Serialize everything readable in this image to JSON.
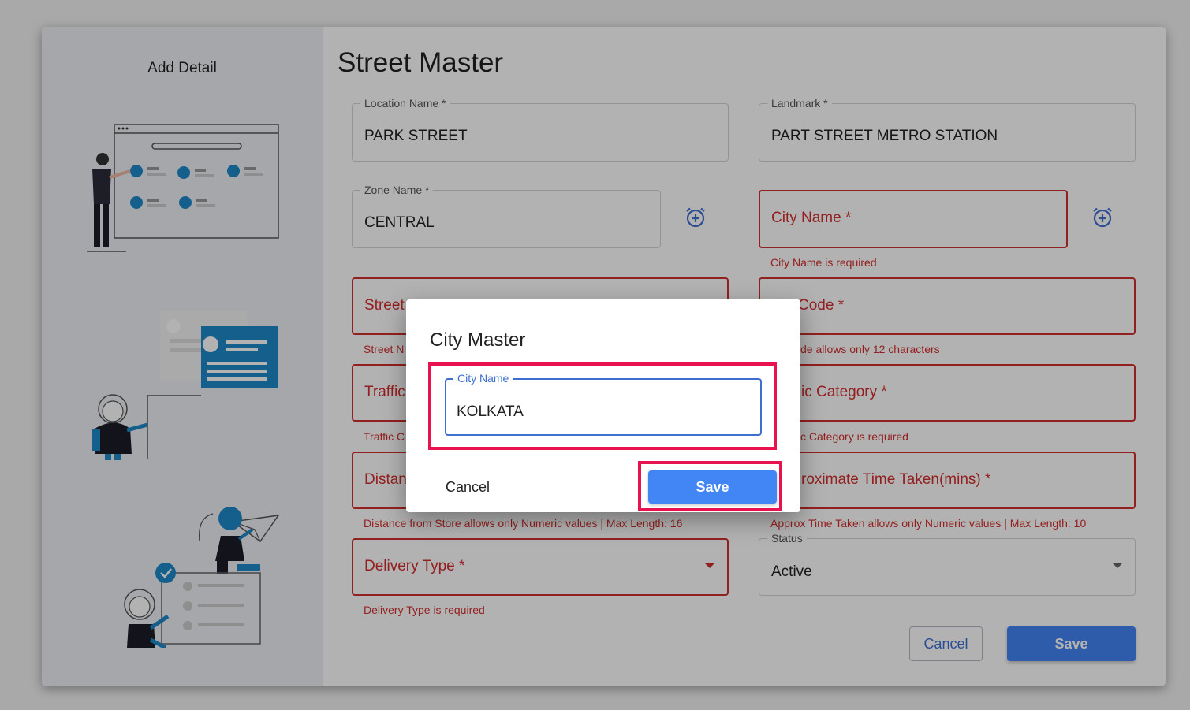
{
  "sidebar": {
    "title": "Add Detail"
  },
  "page": {
    "title": "Street Master"
  },
  "fields": {
    "location_name": {
      "label": "Location Name *",
      "value": "PARK STREET"
    },
    "landmark": {
      "label": "Landmark *",
      "value": "PART STREET METRO STATION"
    },
    "zone_name": {
      "label": "Zone Name *",
      "value": "CENTRAL"
    },
    "city_name": {
      "placeholder": "City Name *",
      "error": "City Name is required"
    },
    "street_name": {
      "placeholder": "Street",
      "error": "Street N"
    },
    "pin_code": {
      "placeholder": "Code *",
      "error": "de allows only 12 characters"
    },
    "traffic": {
      "placeholder": "Traffic",
      "error": "Traffic C"
    },
    "traffic_category": {
      "placeholder": "ic Category *",
      "error": "c Category is required"
    },
    "distance": {
      "placeholder": "Distan",
      "error": "Distance from Store allows only Numeric values | Max Length: 16"
    },
    "approx_time": {
      "placeholder": "roximate Time Taken(mins) *",
      "error": "Approx Time Taken allows only Numeric values | Max Length: 10"
    },
    "delivery_type": {
      "placeholder": "Delivery Type *",
      "error": "Delivery Type is required"
    },
    "status": {
      "label": "Status",
      "value": "Active"
    }
  },
  "actions": {
    "cancel": "Cancel",
    "save": "Save"
  },
  "dialog": {
    "title": "City Master",
    "field_label": "City Name",
    "field_value": "KOLKATA",
    "cancel": "Cancel",
    "save": "Save"
  },
  "colors": {
    "accent": "#4285f4",
    "error": "#d32f2f",
    "highlight": "#e8134e",
    "focus": "#3f6fd1"
  }
}
